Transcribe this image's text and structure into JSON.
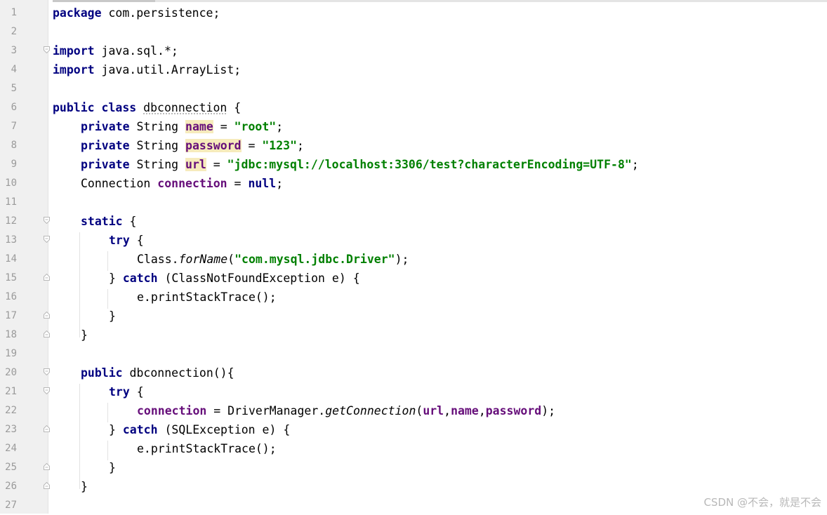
{
  "editor": {
    "line_numbers": [
      "1",
      "2",
      "3",
      "4",
      "5",
      "6",
      "7",
      "8",
      "9",
      "10",
      "11",
      "12",
      "13",
      "14",
      "15",
      "16",
      "17",
      "18",
      "19",
      "20",
      "21",
      "22",
      "23",
      "24",
      "25",
      "26",
      "27"
    ],
    "code": {
      "l1": {
        "kw": "package",
        "rest": " com.persistence;"
      },
      "l3": {
        "kw": "import",
        "rest": " java.sql.*;"
      },
      "l4": {
        "kw": "import",
        "rest": " java.util.ArrayList;"
      },
      "l6": {
        "kw": "public class",
        "name": "dbconnection",
        "rest": " {"
      },
      "l7": {
        "kw": "private",
        "type": " String ",
        "field": "name",
        "eq": " = ",
        "str": "\"root\"",
        "end": ";"
      },
      "l8": {
        "kw": "private",
        "type": " String ",
        "field": "password",
        "eq": " = ",
        "str": "\"123\"",
        "end": ";"
      },
      "l9": {
        "kw": "private",
        "type": " String ",
        "field": "url",
        "eq": " = ",
        "str": "\"jdbc:mysql://localhost:3306/test?characterEncoding=UTF-8\"",
        "end": ";"
      },
      "l10": {
        "type": "Connection ",
        "field": "connection",
        "eq": " = ",
        "kw": "null",
        "end": ";"
      },
      "l12": {
        "kw": "static",
        "rest": " {"
      },
      "l13": {
        "kw": "try",
        "rest": " {"
      },
      "l14": {
        "a": "Class.",
        "method": "forName",
        "b": "(",
        "str": "\"com.mysql.jdbc.Driver\"",
        "c": ");"
      },
      "l15": {
        "a": "} ",
        "kw": "catch",
        "rest": " (ClassNotFoundException e) {"
      },
      "l16": {
        "text": "e.printStackTrace();"
      },
      "l17": {
        "text": "}"
      },
      "l18": {
        "text": "}"
      },
      "l20": {
        "kw": "public",
        "rest": " dbconnection(){"
      },
      "l21": {
        "kw": "try",
        "rest": " {"
      },
      "l22": {
        "field": "connection",
        "eq": " = DriverManager.",
        "method": "getConnection",
        "p": "(",
        "f1": "url",
        "c1": ",",
        "f2": "name",
        "c2": ",",
        "f3": "password",
        "end": ");"
      },
      "l23": {
        "a": "} ",
        "kw": "catch",
        "rest": " (SQLException e) {"
      },
      "l24": {
        "text": "e.printStackTrace();"
      },
      "l25": {
        "text": "}"
      },
      "l26": {
        "text": "}"
      }
    }
  },
  "watermark": "CSDN @不会，就是不会"
}
